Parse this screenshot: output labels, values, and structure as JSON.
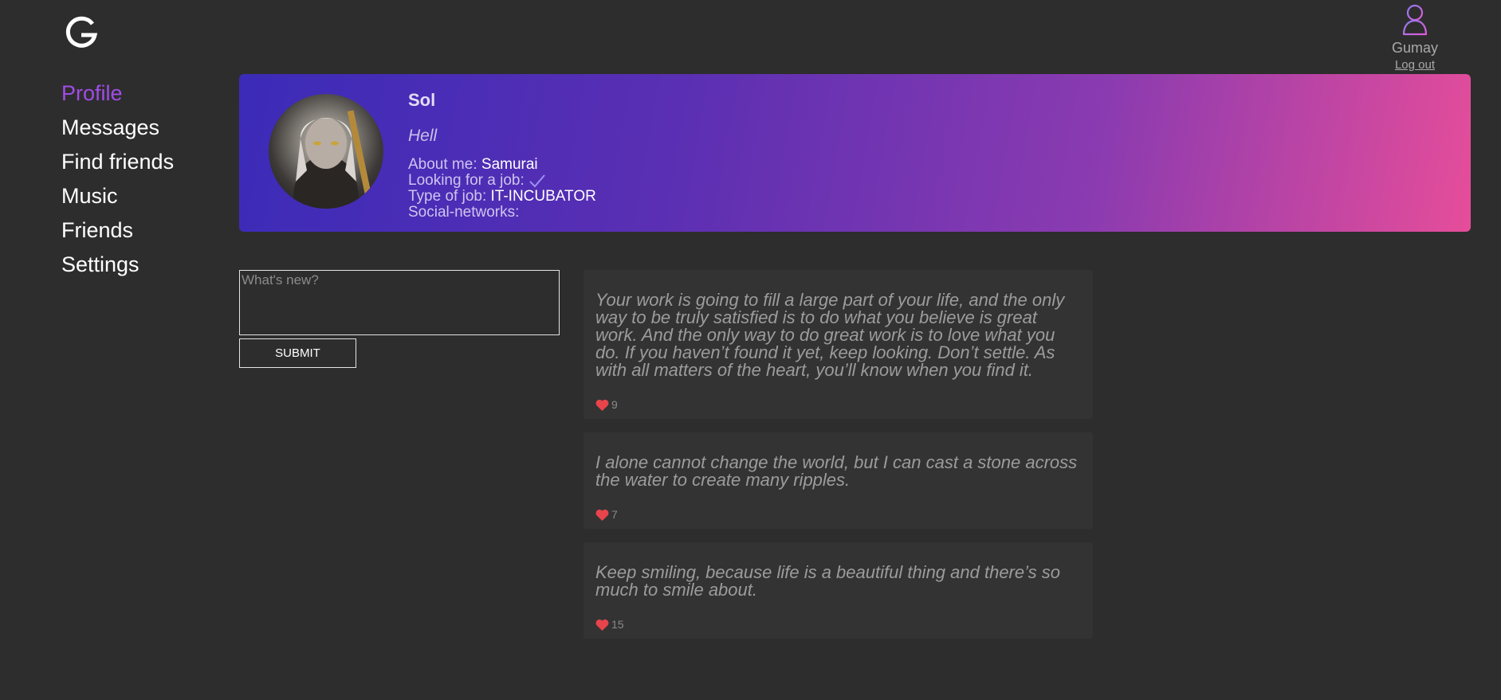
{
  "header": {
    "logo_letter": "G",
    "user": {
      "name": "Gumay",
      "logout_label": "Log out",
      "icon": "user-icon"
    }
  },
  "sidebar": {
    "items": [
      {
        "label": "Profile",
        "active": true
      },
      {
        "label": "Messages",
        "active": false
      },
      {
        "label": "Find friends",
        "active": false
      },
      {
        "label": "Music",
        "active": false
      },
      {
        "label": "Friends",
        "active": false
      },
      {
        "label": "Settings",
        "active": false
      }
    ]
  },
  "profile": {
    "full_name": "Sol",
    "status": "Hell",
    "about_label": "About me: ",
    "about_value": "Samurai",
    "job_label": "Looking for a job: ",
    "job_icon": "checkmark-icon",
    "job_type_label": "Type of job: ",
    "job_type_value": "IT-INCUBATOR",
    "social_label": "Social-networks:"
  },
  "post_form": {
    "placeholder": "What's new?",
    "value": "",
    "submit_label": "SUBMIT"
  },
  "posts": [
    {
      "text": "Your work is going to fill a large part of your life, and the only way to be truly satisfied is to do what you believe is great work. And the only way to do great work is to love what you do. If you haven’t found it yet, keep looking. Don’t settle. As with all matters of the heart, you’ll know when you find it.",
      "likes": "9"
    },
    {
      "text": "I alone cannot change the world, but I can cast a stone across the water to create many ripples.",
      "likes": "7"
    },
    {
      "text": "Keep smiling, because life is a beautiful thing and there’s so much to smile about.",
      "likes": "15"
    }
  ],
  "colors": {
    "background": "#2d2d2d",
    "active_nav": "#a14ce8",
    "heart": "#e8444b",
    "card_gradient_start": "#3b2bb8",
    "card_gradient_end": "#e64d9a"
  }
}
